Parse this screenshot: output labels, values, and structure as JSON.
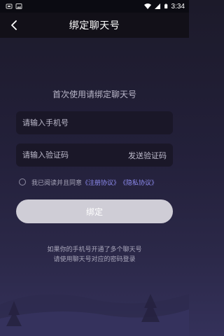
{
  "status_bar": {
    "time": "3:34",
    "icons": [
      "notification-icon",
      "image-icon",
      "wifi-icon",
      "signal-icon",
      "battery-icon"
    ]
  },
  "app_bar": {
    "title": "绑定聊天号",
    "back_icon": "back-arrow-icon"
  },
  "form": {
    "prompt": "首次使用请绑定聊天号",
    "phone_placeholder": "请输入手机号",
    "code_placeholder": "请输入验证码",
    "send_code_label": "发送验证码",
    "agree_text": "我已阅读并且同意",
    "terms_link": "《注册协议》",
    "privacy_link": "《隐私协议》",
    "agreed": false,
    "bind_label": "绑定"
  },
  "hint": {
    "line1": "如果你的手机号开通了多个聊天号",
    "line2": "请使用聊天号对应的密码登录"
  },
  "colors": {
    "background_top": "#1c1a2a",
    "background_bottom": "#34315a",
    "field_bg": "#1a1728",
    "link": "#8e8cf0",
    "button_bg": "#cfcdd6"
  }
}
